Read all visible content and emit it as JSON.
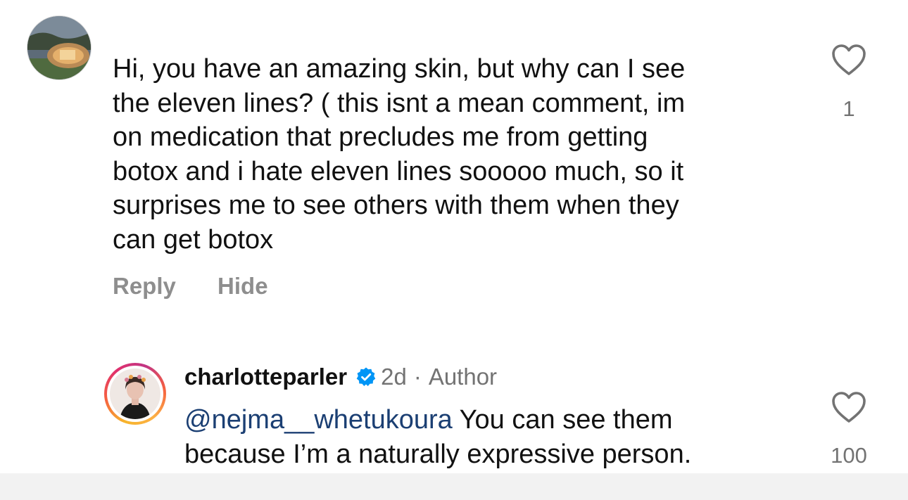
{
  "comments": [
    {
      "text": "Hi, you have an amazing skin, but why can I see the eleven lines? ( this isnt a mean comment, im on medication that precludes me from getting botox and i hate eleven lines sooooo much, so it surprises me to see others with them when they can get botox",
      "lines": [
        "Hi, you have an amazing skin, but why can I see",
        "the eleven lines? ( this isnt a mean comment, im",
        "on medication that precludes me from getting",
        "botox and i hate eleven lines sooooo much, so it",
        "surprises me to see others with them when they",
        "can get botox"
      ],
      "likes": "1",
      "actions": {
        "reply": "Reply",
        "hide": "Hide"
      },
      "avatar_icon": "profile-photo-icon"
    },
    {
      "username": "charlotteparler",
      "verified": true,
      "time": "2d",
      "separator": "·",
      "badge": "Author",
      "mention": "@nejma__whetukoura",
      "text_line1": " You can see them",
      "text_line2": "because I’m a naturally expressive person.",
      "likes": "100",
      "avatar_icon": "profile-photo-icon",
      "story_ring": true
    }
  ],
  "colors": {
    "text": "#111111",
    "muted": "#8e8e8e",
    "mention": "#1b3f73",
    "verified": "#0095f6"
  }
}
